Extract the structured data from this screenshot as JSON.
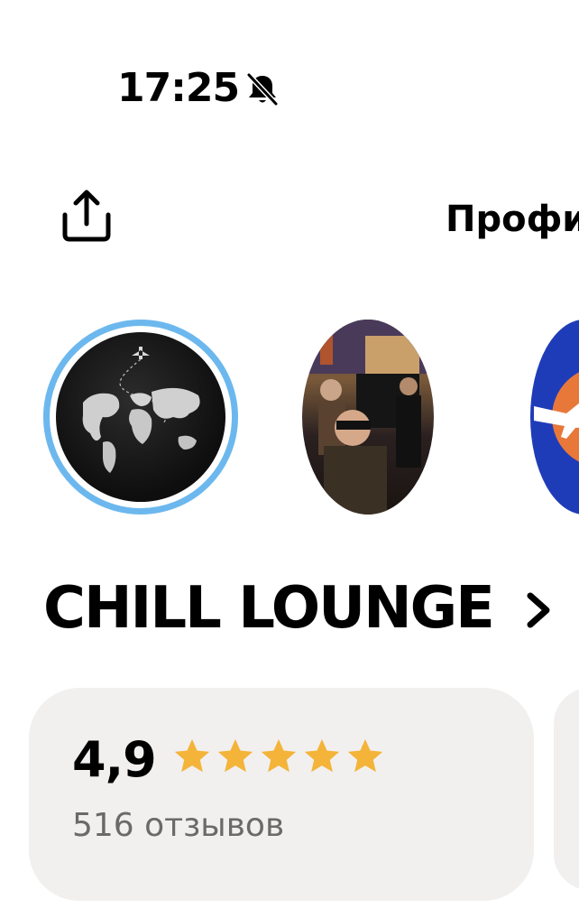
{
  "status_bar": {
    "time": "17:25",
    "notification_icon": "bell-slash-icon"
  },
  "header": {
    "share_icon": "share-icon",
    "title": "Профи"
  },
  "stories": [
    {
      "name": "world-map-story",
      "active": true,
      "ring_color": "#6cb8ee"
    },
    {
      "name": "photo-story",
      "active": false
    },
    {
      "name": "airline-story",
      "active": false
    }
  ],
  "place": {
    "title": "CHILL LOUNGE",
    "chevron_icon": "chevron-right-icon"
  },
  "rating": {
    "value": "4,9",
    "stars": 5,
    "star_color": "#f4b43a",
    "reviews": "516 отзывов"
  },
  "colors": {
    "card_background": "#f1f0ef",
    "secondary_text": "#6a6a6a"
  }
}
